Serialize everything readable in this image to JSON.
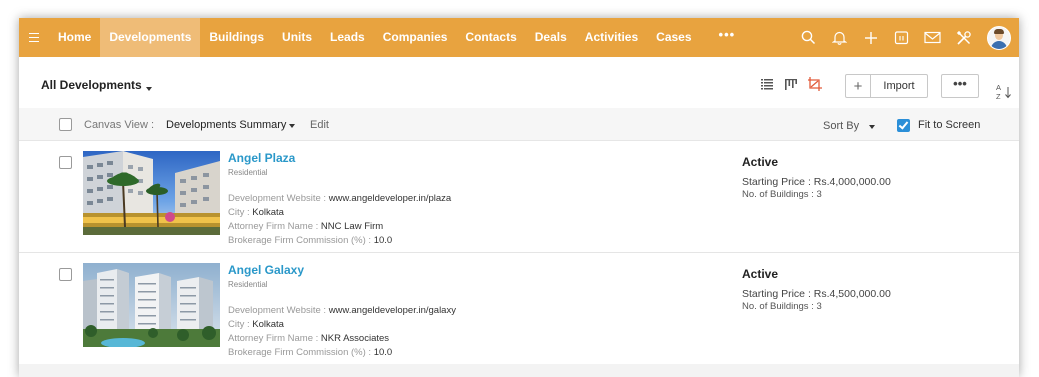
{
  "nav": {
    "items": [
      "Home",
      "Developments",
      "Buildings",
      "Units",
      "Leads",
      "Companies",
      "Contacts",
      "Deals",
      "Activities",
      "Cases"
    ],
    "active_index": 1,
    "more": "•••",
    "icons": [
      "search-icon",
      "bell-icon",
      "plus-icon",
      "calendar-icon",
      "mail-icon",
      "tools-icon",
      "avatar"
    ]
  },
  "toolbar": {
    "view_title": "All Developments",
    "import_label": "Import",
    "plus_label": "+",
    "more_label": "•••",
    "sort_label": "A↓Z"
  },
  "filterbar": {
    "canvas_label": "Canvas View :",
    "canvas_value": "Developments Summary",
    "edit_label": "Edit",
    "sort_by_label": "Sort By",
    "fit_label": "Fit to Screen",
    "fit_checked": true
  },
  "records": [
    {
      "name": "Angel Plaza",
      "type": "Residential",
      "fields": [
        {
          "label": "Development Website :",
          "value": "www.angeldeveloper.in/plaza"
        },
        {
          "label": "City :",
          "value": "Kolkata"
        },
        {
          "label": "Attorney Firm Name :",
          "value": "NNC Law Firm"
        },
        {
          "label": "Brokerage Firm Commission (%) :",
          "value": "10.0"
        }
      ],
      "status": "Active",
      "price": "Starting Price : Rs.4,000,000.00",
      "buildings": "No. of Buildings : 3"
    },
    {
      "name": "Angel Galaxy",
      "type": "Residential",
      "fields": [
        {
          "label": "Development Website :",
          "value": "www.angeldeveloper.in/galaxy"
        },
        {
          "label": "City :",
          "value": "Kolkata"
        },
        {
          "label": "Attorney Firm Name :",
          "value": "NKR Associates"
        },
        {
          "label": "Brokerage Firm Commission (%) :",
          "value": "10.0"
        }
      ],
      "status": "Active",
      "price": "Starting Price : Rs.4,500,000.00",
      "buildings": "No. of Buildings : 3"
    }
  ],
  "colors": {
    "nav_bg": "#e8a33f",
    "nav_active": "#efbc77",
    "link": "#2a98c9",
    "checkbox_on": "#2b8fd8"
  }
}
